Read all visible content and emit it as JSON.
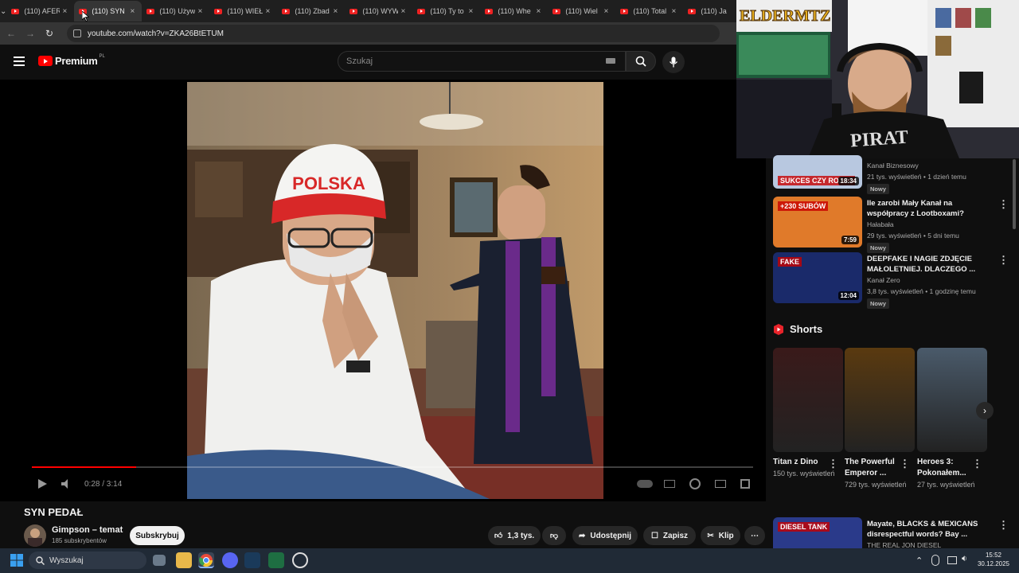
{
  "browser": {
    "tabs": [
      {
        "label": "(110) AFER",
        "active": false
      },
      {
        "label": "(110) SYN",
        "active": true
      },
      {
        "label": "(110) Używ",
        "active": false
      },
      {
        "label": "(110) WIEŁ",
        "active": false
      },
      {
        "label": "(110) Zbad",
        "active": false
      },
      {
        "label": "(110) WYW",
        "active": false
      },
      {
        "label": "(110) Ty to",
        "active": false
      },
      {
        "label": "(110) Whe",
        "active": false
      },
      {
        "label": "(110) Wiel",
        "active": false
      },
      {
        "label": "(110) Total",
        "active": false
      },
      {
        "label": "(110) Ja",
        "active": false
      }
    ],
    "url": "youtube.com/watch?v=ZKA26BtETUM"
  },
  "header": {
    "logo_text": "Premium",
    "region": "PL",
    "search_placeholder": "Szukaj"
  },
  "player": {
    "time_current": "0:28",
    "time_total": "3:14",
    "time_label": "0:28 / 3:14",
    "progress": 0.145,
    "thumbnail_cap_text": "POLSKA"
  },
  "video": {
    "title": "SYN PEDAŁ",
    "channel": "Gimpson – temat",
    "subscribers": "185 subskrybentów",
    "subscribe_label": "Subskrybuj",
    "likes": "1,3 tys.",
    "share_label": "Udostępnij",
    "save_label": "Zapisz",
    "clip_label": "Klip"
  },
  "webcam": {
    "overlay_text": "ELDERMTZ",
    "shirt_text": "PIRAT"
  },
  "recommendations": [
    {
      "title": "",
      "channel": "Kanał Biznesowy",
      "meta": "21 tys. wyświetleń • 1 dzień temu",
      "badge": "Nowy",
      "duration": "18:34",
      "thumb_text": "SUKCES CZY ROZCZ",
      "thumb_color": "#b8c8e0"
    },
    {
      "title": "Ile zarobi Mały Kanał na współpracy z Lootboxami?",
      "channel": "Hałabała",
      "meta": "29 tys. wyświetleń • 5 dni temu",
      "badge": "Nowy",
      "duration": "7:59",
      "thumb_text": "+230 SUBÓW",
      "thumb_color": "#e07a2a"
    },
    {
      "title": "DEEPFAKE I NAGIE ZDJĘCIE MAŁOLETNIEJ. DLACZEGO ...",
      "channel": "Kanał Zero",
      "meta": "3,8 tys. wyświetleń • 1 godzinę temu",
      "badge": "Nowy",
      "duration": "12:04",
      "thumb_text": "FAKE",
      "thumb_color": "#1a2a6a"
    },
    {
      "title": "Mayate, BLACKS & MEXICANS disrespectful words? Bay ...",
      "channel": "THE REAL JON DIESEL",
      "meta": "",
      "badge": "",
      "duration": "",
      "thumb_text": "DIESEL TANK",
      "thumb_color": "#2a3a8a"
    }
  ],
  "shorts": {
    "heading": "Shorts",
    "items": [
      {
        "title": "Titan z Dino",
        "views": "150 tys. wyświetleń"
      },
      {
        "title": "The Powerful Emperor ...",
        "views": "729 tys. wyświetleń"
      },
      {
        "title": "Heroes 3: Pokonałem...",
        "views": "27 tys. wyświetleń"
      }
    ]
  },
  "taskbar": {
    "search_label": "Wyszukaj",
    "time": "15:52",
    "date": "30.12.2025"
  },
  "colors": {
    "accent": "#ff0000",
    "background": "#0f0f0f",
    "taskbar": "#202a36"
  }
}
